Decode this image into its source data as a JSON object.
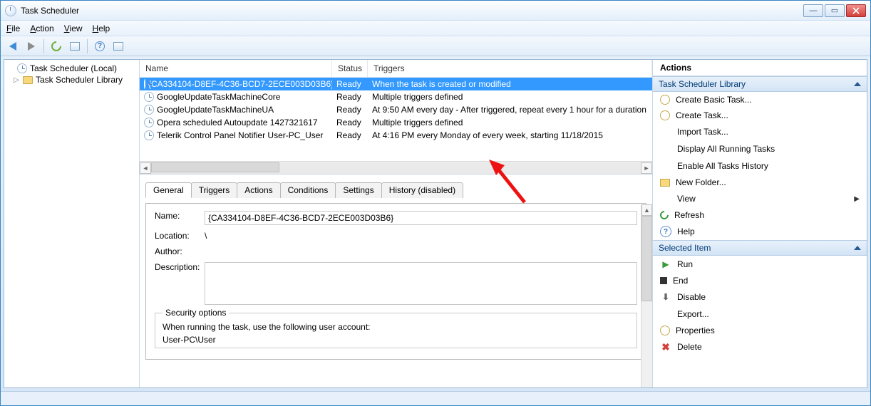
{
  "window": {
    "title": "Task Scheduler"
  },
  "menu": {
    "file": "File",
    "action": "Action",
    "view": "View",
    "help": "Help"
  },
  "tree": {
    "root": "Task Scheduler (Local)",
    "library": "Task Scheduler Library"
  },
  "columns": {
    "name": "Name",
    "status": "Status",
    "triggers": "Triggers"
  },
  "tasks": [
    {
      "name": "{CA334104-D8EF-4C36-BCD7-2ECE003D03B6}",
      "status": "Ready",
      "trigger": "When the task is created or modified",
      "selected": true
    },
    {
      "name": "GoogleUpdateTaskMachineCore",
      "status": "Ready",
      "trigger": "Multiple triggers defined"
    },
    {
      "name": "GoogleUpdateTaskMachineUA",
      "status": "Ready",
      "trigger": "At 9:50 AM every day - After triggered, repeat every 1 hour for a duration"
    },
    {
      "name": "Opera scheduled Autoupdate 1427321617",
      "status": "Ready",
      "trigger": "Multiple triggers defined"
    },
    {
      "name": "Telerik Control Panel Notifier User-PC_User",
      "status": "Ready",
      "trigger": "At 4:16 PM every Monday of every week, starting 11/18/2015"
    }
  ],
  "tabs": {
    "general": "General",
    "triggers": "Triggers",
    "actions": "Actions",
    "conditions": "Conditions",
    "settings": "Settings",
    "history": "History (disabled)"
  },
  "details": {
    "name_label": "Name:",
    "name_value": "{CA334104-D8EF-4C36-BCD7-2ECE003D03B6}",
    "location_label": "Location:",
    "location_value": "\\",
    "author_label": "Author:",
    "author_value": "",
    "description_label": "Description:",
    "description_value": "",
    "security_legend": "Security options",
    "security_note": "When running the task, use the following user account:",
    "security_account": "User-PC\\User"
  },
  "actions": {
    "panel_title": "Actions",
    "section1": "Task Scheduler Library",
    "items1": [
      "Create Basic Task...",
      "Create Task...",
      "Import Task...",
      "Display All Running Tasks",
      "Enable All Tasks History",
      "New Folder...",
      "View",
      "Refresh",
      "Help"
    ],
    "section2": "Selected Item",
    "items2": [
      "Run",
      "End",
      "Disable",
      "Export...",
      "Properties",
      "Delete"
    ]
  }
}
